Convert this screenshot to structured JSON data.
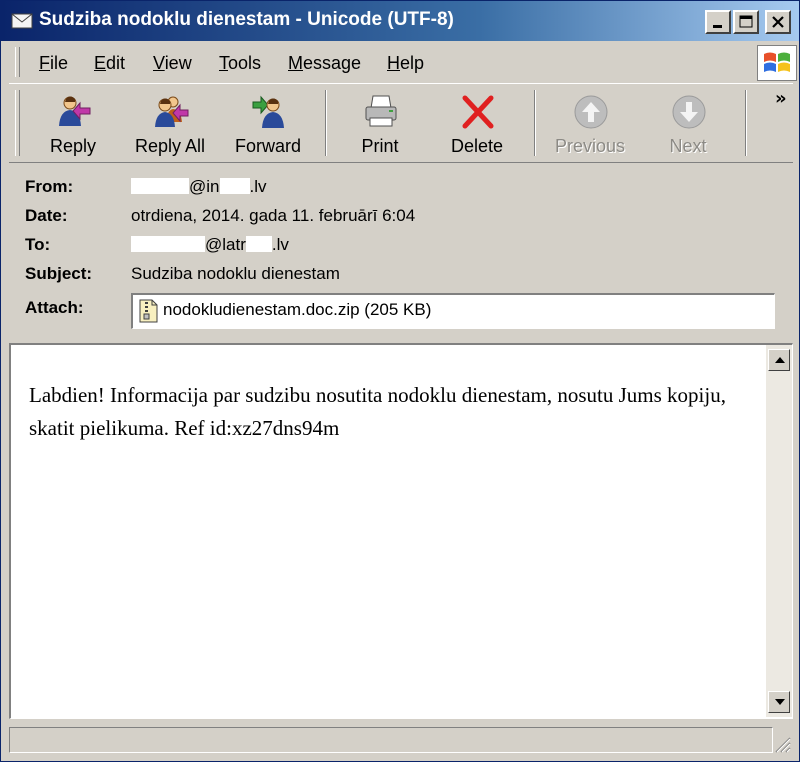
{
  "window": {
    "title": "Sudziba nodoklu dienestam - Unicode (UTF-8)"
  },
  "menu": {
    "items": [
      {
        "label": "File",
        "accel": "F",
        "rest": "ile"
      },
      {
        "label": "Edit",
        "accel": "E",
        "rest": "dit"
      },
      {
        "label": "View",
        "accel": "V",
        "rest": "iew"
      },
      {
        "label": "Tools",
        "accel": "T",
        "rest": "ools"
      },
      {
        "label": "Message",
        "accel": "M",
        "rest": "essage"
      },
      {
        "label": "Help",
        "accel": "H",
        "rest": "elp"
      }
    ]
  },
  "toolbar": {
    "reply": "Reply",
    "reply_all": "Reply All",
    "forward": "Forward",
    "print": "Print",
    "delete": "Delete",
    "previous": "Previous",
    "next": "Next",
    "overflow": "»"
  },
  "header": {
    "from_label": "From:",
    "from_value_suffix_1": "@in",
    "from_value_suffix_2": ".lv",
    "date_label": "Date:",
    "date_value": "otrdiena, 2014. gada 11. februārī 6:04",
    "to_label": "To:",
    "to_value_mid": "@latr",
    "to_value_end": ".lv",
    "subject_label": "Subject:",
    "subject_value": "Sudziba nodoklu dienestam",
    "attach_label": "Attach:",
    "attachment": "nodokludienestam.doc.zip (205 KB)"
  },
  "message": {
    "body": "Labdien! Informacija par sudzibu nosutita nodoklu dienestam, nosutu Jums kopiju, skatit pielikuma. Ref id:xz27dns94m"
  },
  "colors": {
    "title_start": "#0a246a",
    "title_end": "#a6caf0",
    "chrome": "#d4d0c8",
    "delete_red": "#e02020"
  },
  "icons": {
    "title": "envelope-icon",
    "reply": "reply-icon",
    "reply_all": "reply-all-icon",
    "forward": "forward-icon",
    "print": "printer-icon",
    "delete": "delete-x-icon",
    "previous": "arrow-up-icon",
    "next": "arrow-down-icon",
    "attachment": "zip-file-icon"
  }
}
